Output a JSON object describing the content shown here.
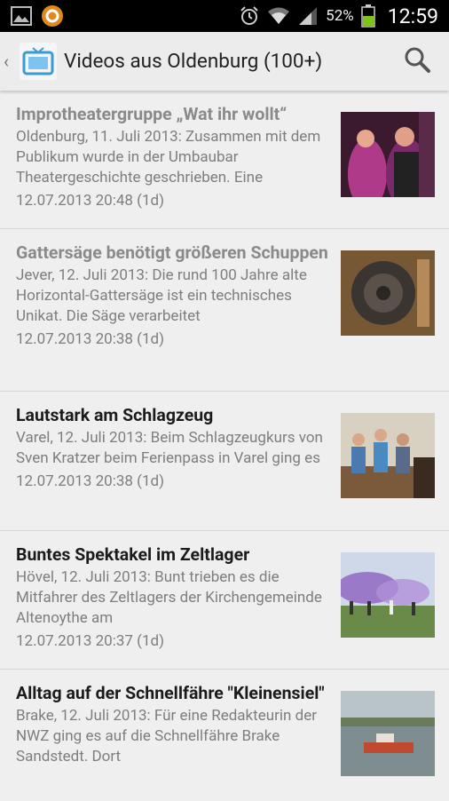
{
  "status_bar": {
    "left_icons": [
      "gallery-icon",
      "app-notification-icon"
    ],
    "right_icons": [
      "alarm-icon",
      "wifi-icon",
      "signal-icon",
      "battery-icon"
    ],
    "battery": "52%",
    "time": "12:59"
  },
  "action_bar": {
    "title": "Videos aus Oldenburg (100+)",
    "icon": "tv-icon",
    "search_icon": "search-icon"
  },
  "articles": [
    {
      "title": "Improtheatergruppe „Wat ihr wollt“",
      "snippet": "Oldenburg, 11. Juli 2013: Zusammen mit dem Publikum wurde in der Umbaubar Theatergeschichte geschrieben. Eine",
      "date": "12.07.2013 20:48 (1d)",
      "read": true
    },
    {
      "title": "Gattersäge benötigt größeren Schuppen",
      "snippet": "Jever, 12. Juli 2013: Die rund 100 Jahre alte Horizontal-Gattersäge ist ein technisches Unikat. Die Säge verarbeitet",
      "date": "12.07.2013 20:38 (1d)",
      "read": true
    },
    {
      "title": "Lautstark am Schlagzeug",
      "snippet": "Varel, 12. Juli 2013: Beim Schlagzeugkurs von Sven Kratzer beim Ferienpass in Varel ging es",
      "date": "12.07.2013 20:38 (1d)",
      "read": false
    },
    {
      "title": "Buntes Spektakel im Zeltlager",
      "snippet": "Hövel, 12. Juli 2013: Bunt trieben es die Mitfahrer des Zeltlagers der Kirchengemeinde Altenoythe am",
      "date": "12.07.2013 20:37 (1d)",
      "read": false
    },
    {
      "title": "Alltag auf der Schnellfähre \"Kleinensiel\"",
      "snippet": "Brake, 12. Juli 2013: Für eine Redakteurin der NWZ ging es auf die Schnellfähre Brake Sandstedt. Dort",
      "date": "",
      "read": false
    }
  ]
}
